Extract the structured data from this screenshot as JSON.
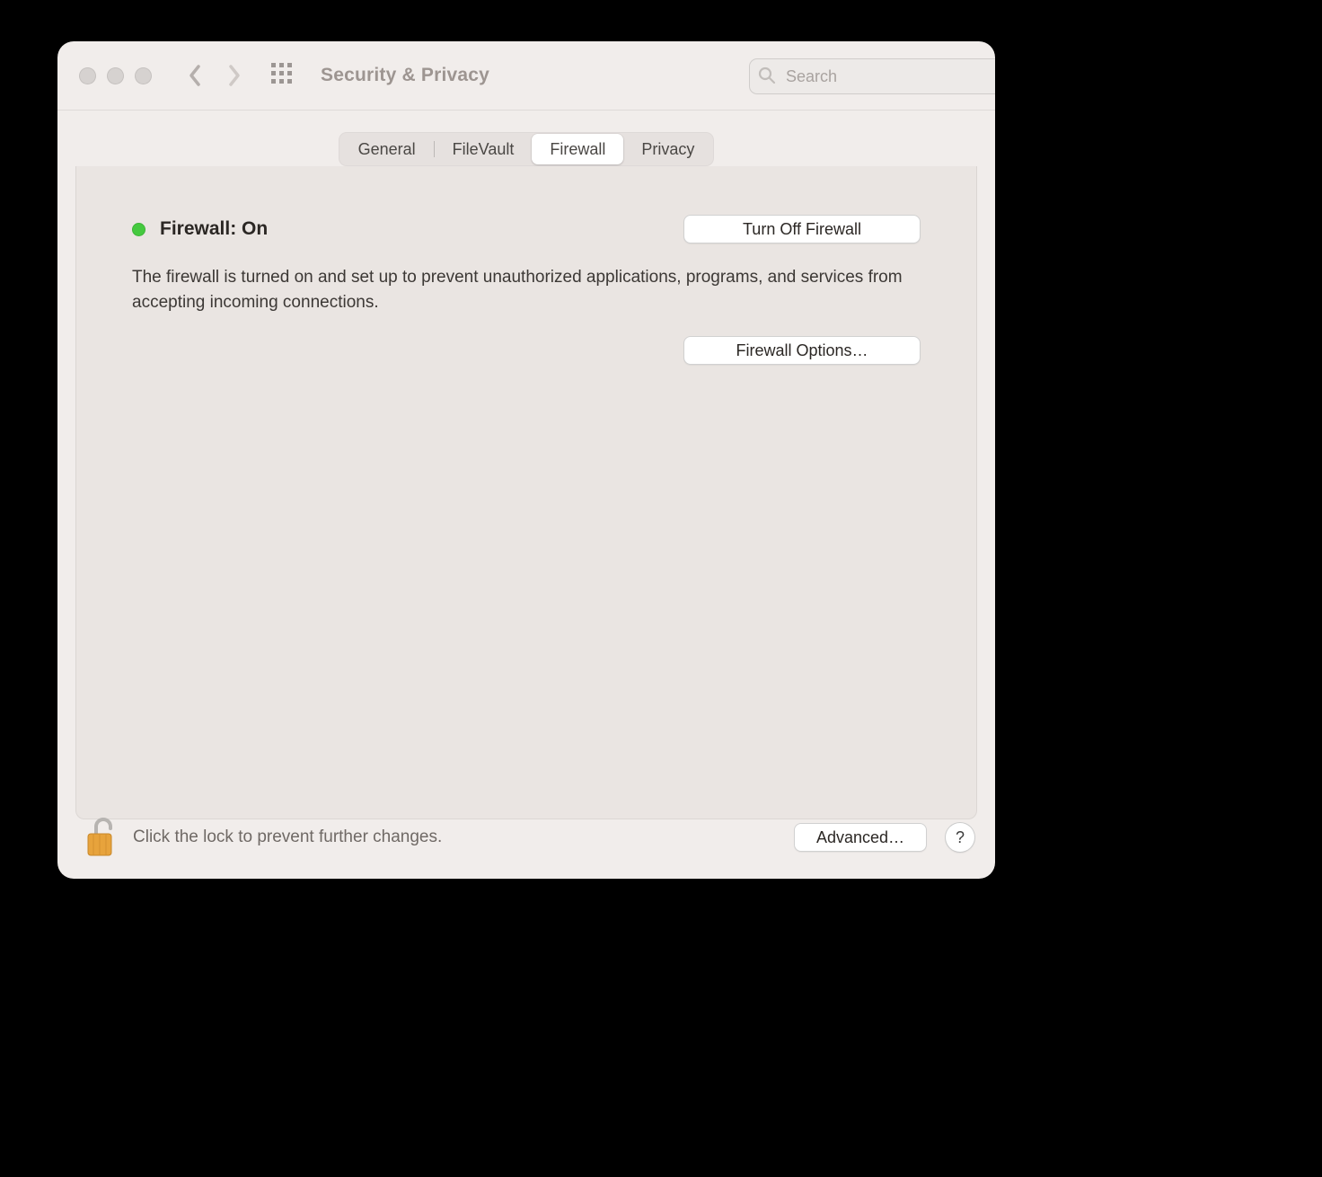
{
  "window": {
    "title": "Security & Privacy"
  },
  "search": {
    "placeholder": "Search"
  },
  "tabs": [
    {
      "label": "General"
    },
    {
      "label": "FileVault"
    },
    {
      "label": "Firewall"
    },
    {
      "label": "Privacy"
    }
  ],
  "active_tab_index": 2,
  "firewall": {
    "status_label": "Firewall: On",
    "status_color": "#45c93f",
    "toggle_button": "Turn Off Firewall",
    "description": "The firewall is turned on and set up to prevent unauthorized applications, programs, and services from accepting incoming connections.",
    "options_button": "Firewall Options…"
  },
  "footer": {
    "lock_hint": "Click the lock to prevent further changes.",
    "advanced_button": "Advanced…",
    "help_label": "?"
  }
}
